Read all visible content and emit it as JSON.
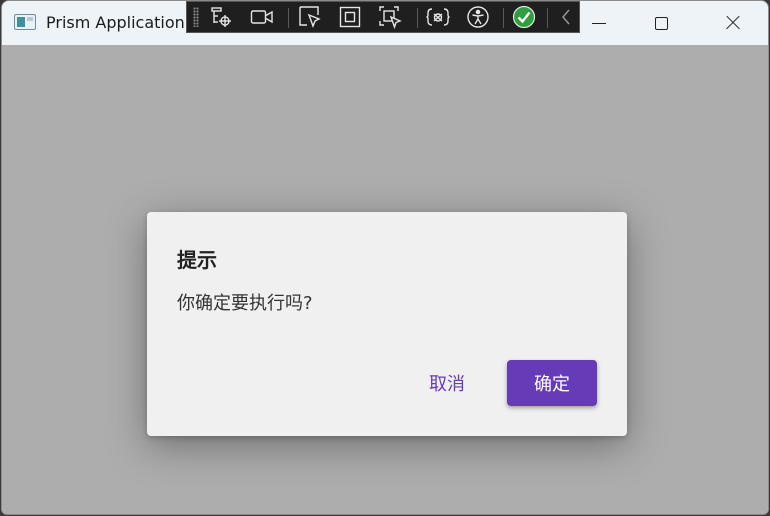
{
  "window": {
    "title": "Prism Application"
  },
  "debug_toolbar": {
    "tools": [
      {
        "icon": "visual-tree-select-icon"
      },
      {
        "icon": "record-video-icon"
      },
      {
        "icon": "select-element-icon"
      },
      {
        "icon": "display-layout-adorners-icon"
      },
      {
        "icon": "track-focused-element-icon"
      },
      {
        "icon": "binding-failures-icon"
      },
      {
        "icon": "accessibility-icon"
      },
      {
        "icon": "hot-reload-status-icon"
      },
      {
        "icon": "collapse-toolbar-icon"
      }
    ]
  },
  "dialog": {
    "title": "提示",
    "message": "你确定要执行吗?",
    "cancel_label": "取消",
    "confirm_label": "确定"
  },
  "colors": {
    "accent": "#673ab7",
    "overlay": "#adadad",
    "dialog_bg": "#f0f0f0",
    "hot_reload_ok": "#2e9e3e"
  }
}
